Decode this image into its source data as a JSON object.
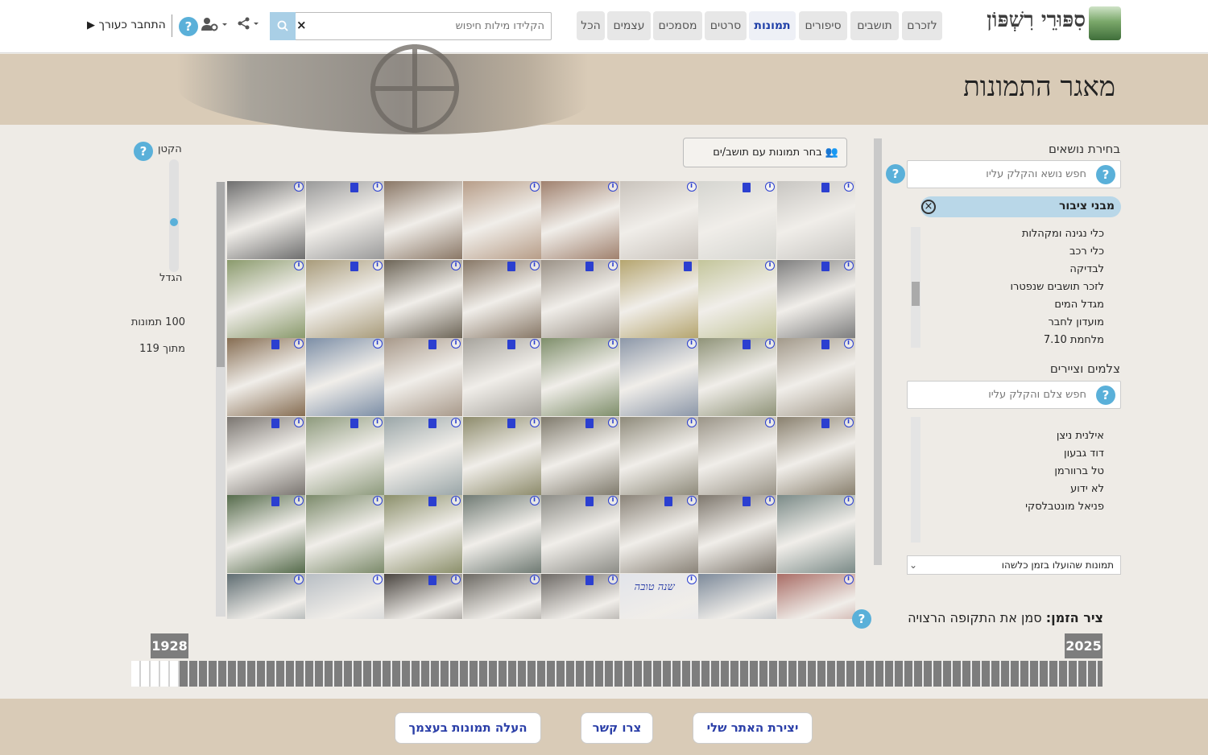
{
  "nav": {
    "brand": "סִפּוּרֵי רִשְׁפּוֹן",
    "tabs": [
      {
        "label": "לזכרם",
        "active": false
      },
      {
        "label": "תושבים",
        "active": false
      },
      {
        "label": "סיפורים",
        "active": false
      },
      {
        "label": "תמונות",
        "active": true
      },
      {
        "label": "סרטים",
        "active": false
      },
      {
        "label": "מסמכים",
        "active": false
      },
      {
        "label": "עצמים",
        "active": false
      },
      {
        "label": "הכל",
        "active": false
      }
    ],
    "search_placeholder": "הקלידו מילות חיפוש",
    "search_clear": "×",
    "login_label": "התחבר כעורך",
    "help": "?"
  },
  "header": {
    "title": "מאגר התמונות"
  },
  "sidebar": {
    "topics_label": "בחירת נושאים",
    "topics_search_placeholder": "חפש נושא והקלק עליו",
    "selected_topic": "מבני ציבור",
    "topics": [
      "כלי נגינה ומקהלות",
      "כלי רכב",
      "לבדיקה",
      "לזכר תושבים שנפטרו",
      "מגדל המים",
      "מועדון לחבר",
      "מלחמת 7.10"
    ],
    "photographers_label": "צלמים וציירים",
    "photographers_search_placeholder": "חפש צלם והקלק עליו",
    "photographers": [
      "אילנית ניצן",
      "דוד גבעון",
      "טל ברוורמן",
      "לא ידוע",
      "פניאל מונטבלסקי"
    ],
    "period_select": "תמונות שהועלו בזמן כלשהו"
  },
  "gallery": {
    "pick_resident_button": "בחר תמונות עם תושב/ים",
    "zoom_small_label": "הקטן",
    "zoom_large_label": "הגדל",
    "shown_count": "100 תמונות",
    "total_count": "מתוך 119",
    "thumb_caption": "שנה טובה",
    "thumbnails": [
      {
        "tone": "#6e6e6e",
        "doc": false,
        "info": true
      },
      {
        "tone": "#9a9a9a",
        "doc": true,
        "info": true
      },
      {
        "tone": "#8a7766",
        "doc": false,
        "info": false
      },
      {
        "tone": "#b79d88",
        "doc": false,
        "info": true
      },
      {
        "tone": "#a0816e",
        "doc": false,
        "info": true
      },
      {
        "tone": "#c9c3bc",
        "doc": false,
        "info": true
      },
      {
        "tone": "#d5d5d0",
        "doc": true,
        "info": true
      },
      {
        "tone": "#c8c6c2",
        "doc": true,
        "info": true
      },
      {
        "tone": "#8a9a6c",
        "doc": false,
        "info": true
      },
      {
        "tone": "#a89b7a",
        "doc": true,
        "info": true
      },
      {
        "tone": "#6d6557",
        "doc": false,
        "info": true
      },
      {
        "tone": "#877766",
        "doc": true,
        "info": true
      },
      {
        "tone": "#9a9186",
        "doc": true,
        "info": true
      },
      {
        "tone": "#b5a56f",
        "doc": true,
        "info": false
      },
      {
        "tone": "#c3c59a",
        "doc": false,
        "info": true
      },
      {
        "tone": "#7e7e7e",
        "doc": true,
        "info": true
      },
      {
        "tone": "#866d52",
        "doc": true,
        "info": true
      },
      {
        "tone": "#7c8ea6",
        "doc": false,
        "info": true
      },
      {
        "tone": "#a8998a",
        "doc": true,
        "info": true
      },
      {
        "tone": "#a6a39c",
        "doc": true,
        "info": true
      },
      {
        "tone": "#7e8e6a",
        "doc": false,
        "info": true
      },
      {
        "tone": "#8c97a8",
        "doc": false,
        "info": true
      },
      {
        "tone": "#8f9378",
        "doc": true,
        "info": true
      },
      {
        "tone": "#a2998a",
        "doc": true,
        "info": true
      },
      {
        "tone": "#7a7570",
        "doc": true,
        "info": true
      },
      {
        "tone": "#8d9a7c",
        "doc": true,
        "info": true
      },
      {
        "tone": "#9aa6a8",
        "doc": true,
        "info": true
      },
      {
        "tone": "#8d8b6b",
        "doc": true,
        "info": true
      },
      {
        "tone": "#7f7a6c",
        "doc": true,
        "info": true
      },
      {
        "tone": "#8e8a7a",
        "doc": false,
        "info": true
      },
      {
        "tone": "#9a9487",
        "doc": false,
        "info": true
      },
      {
        "tone": "#89806e",
        "doc": true,
        "info": true
      },
      {
        "tone": "#556b4b",
        "doc": true,
        "info": true
      },
      {
        "tone": "#7b8a6a",
        "doc": false,
        "info": true
      },
      {
        "tone": "#8b8f6a",
        "doc": true,
        "info": true
      },
      {
        "tone": "#6f7a73",
        "doc": false,
        "info": true
      },
      {
        "tone": "#8c8c86",
        "doc": true,
        "info": true
      },
      {
        "tone": "#8a8378",
        "doc": true,
        "info": true
      },
      {
        "tone": "#7d766c",
        "doc": true,
        "info": true
      },
      {
        "tone": "#7a8a87",
        "doc": false,
        "info": true
      },
      {
        "tone": "#5f6d72",
        "doc": false,
        "info": true
      },
      {
        "tone": "#b8bec4",
        "doc": false,
        "info": true
      },
      {
        "tone": "#4a4540",
        "doc": true,
        "info": true
      },
      {
        "tone": "#6c6963",
        "doc": false,
        "info": true
      },
      {
        "tone": "#6e6a66",
        "doc": true,
        "info": true
      },
      {
        "tone": "#e2e4ea",
        "doc": false,
        "info": true
      },
      {
        "tone": "#7d8a9a",
        "doc": false,
        "info": false
      },
      {
        "tone": "#a96d66",
        "doc": false,
        "info": true
      }
    ]
  },
  "timeline": {
    "label_bold": "ציר הזמן:",
    "label_text": "סמן את התקופה הרצויה",
    "start_year": "1928",
    "end_year": "2025"
  },
  "footer": {
    "create_site": "יצירת האתר שלי",
    "contact": "צרו קשר",
    "upload_photos": "העלה תמונות בעצמך"
  },
  "colors": {
    "accent": "#5ab0d9",
    "link": "#2b3fa8",
    "band": "#d9cbb7",
    "chip": "#b9d7e8"
  }
}
